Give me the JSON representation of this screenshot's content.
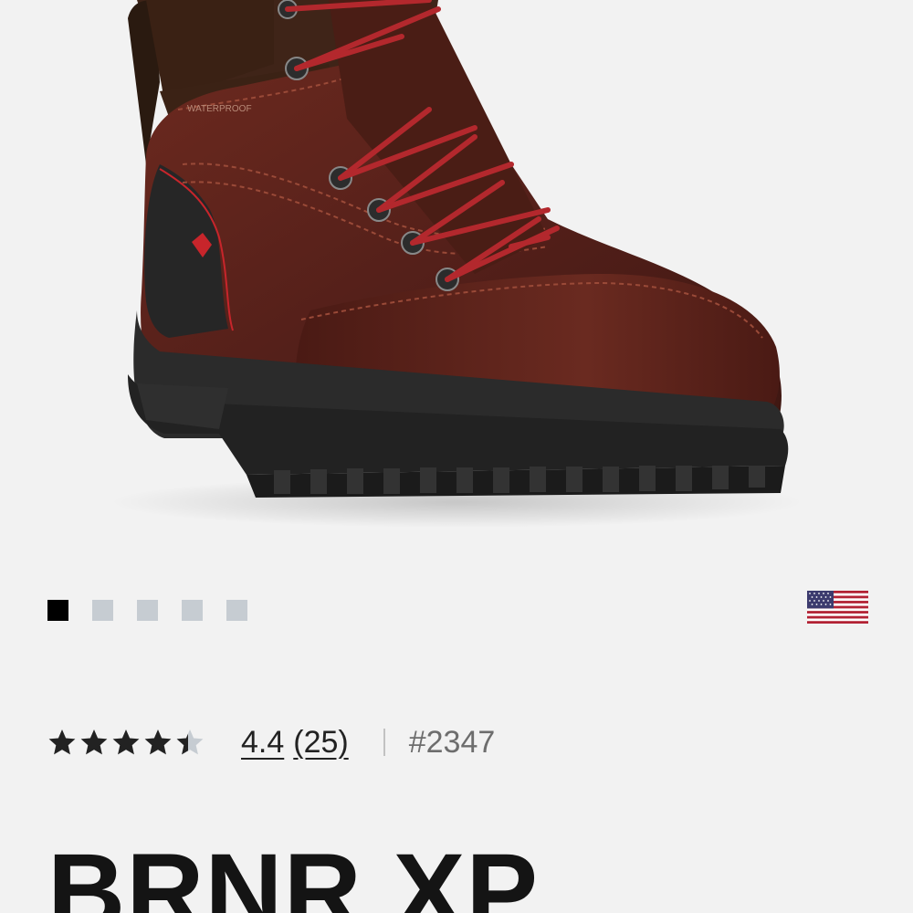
{
  "product": {
    "image_alt": "Brown leather work boot with red laces",
    "title": "BRNR XP",
    "style_number": "#2347"
  },
  "rating": {
    "score": "4.4",
    "count": "(25)",
    "stars_value": 4.4,
    "stars_max": 5
  },
  "carousel": {
    "total": 5,
    "active_index": 0
  },
  "region": {
    "flag_icon": "us-flag-icon"
  },
  "colors": {
    "background": "#f2f2f2",
    "dot_active": "#000000",
    "dot_inactive": "#c6ccd2",
    "leather": "#5a2119",
    "laces": "#b3282d",
    "sole": "#2a2a2a"
  }
}
